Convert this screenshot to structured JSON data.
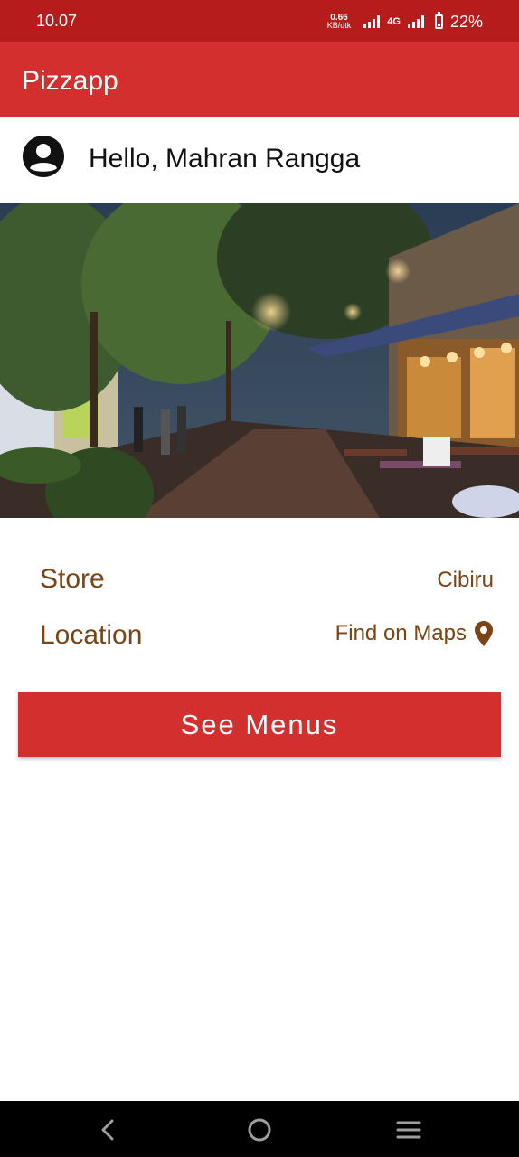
{
  "status_bar": {
    "time": "10.07",
    "net_speed_value": "0.66",
    "net_speed_unit": "KB/dtk",
    "network_type": "4G",
    "battery_percent": "22%",
    "battery_level": 0.22
  },
  "app_bar": {
    "title": "Pizzapp"
  },
  "greeting": {
    "text": "Hello, Mahran Rangga",
    "icon": "account-circle-icon"
  },
  "store": {
    "label": "Store",
    "value": "Cibiru"
  },
  "location": {
    "label": "Location",
    "value": "Find on Maps",
    "icon": "map-pin-icon"
  },
  "see_menus_button": {
    "label": "See Menus"
  },
  "colors": {
    "status_bar": "#b71c1c",
    "primary": "#d32f2f",
    "label_brown": "#7a4414"
  },
  "nav_bar": {
    "buttons": [
      "back-icon",
      "home-icon",
      "recents-icon"
    ]
  }
}
